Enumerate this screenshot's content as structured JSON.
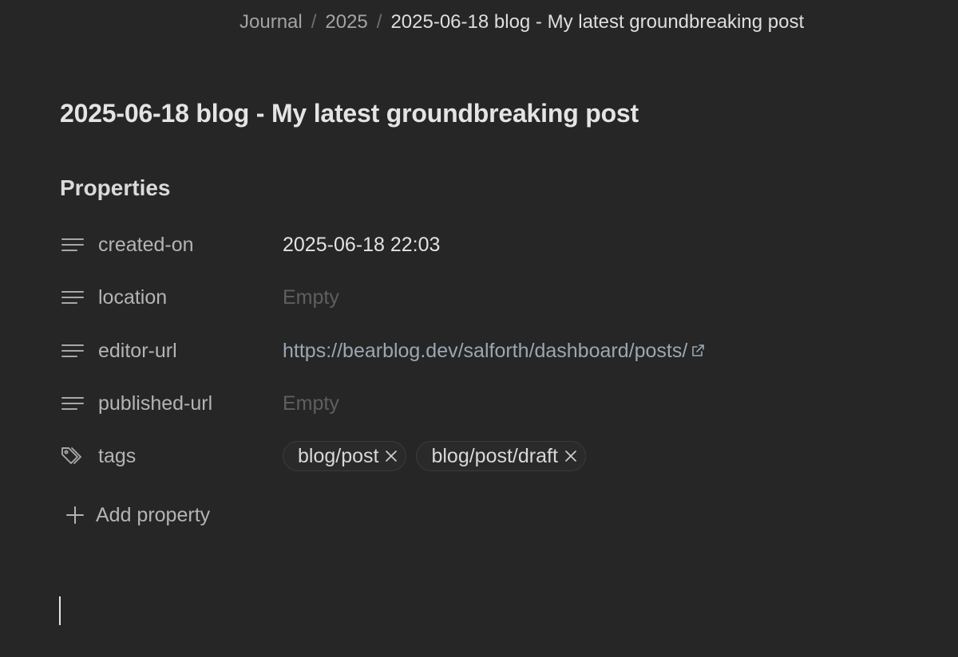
{
  "breadcrumb": {
    "items": [
      "Journal",
      "2025",
      "2025-06-18 blog - My latest groundbreaking post"
    ],
    "separator": "/"
  },
  "note": {
    "title": "2025-06-18 blog - My latest groundbreaking post"
  },
  "properties": {
    "heading": "Properties",
    "rows": [
      {
        "name": "created-on",
        "icon": "text-lines-icon",
        "value": "2025-06-18 22:03",
        "kind": "text"
      },
      {
        "name": "location",
        "icon": "text-lines-icon",
        "value": "Empty",
        "kind": "empty"
      },
      {
        "name": "editor-url",
        "icon": "text-lines-icon",
        "value": "https://bearblog.dev/salforth/dashboard/posts/",
        "kind": "link"
      },
      {
        "name": "published-url",
        "icon": "text-lines-icon",
        "value": "Empty",
        "kind": "empty"
      },
      {
        "name": "tags",
        "icon": "tags-icon",
        "kind": "tags",
        "tags": [
          "blog/post",
          "blog/post/draft"
        ]
      }
    ],
    "add_label": "Add property"
  },
  "colors": {
    "background": "#262626",
    "link": "#9aa7b2",
    "empty": "#5f5f5f"
  }
}
